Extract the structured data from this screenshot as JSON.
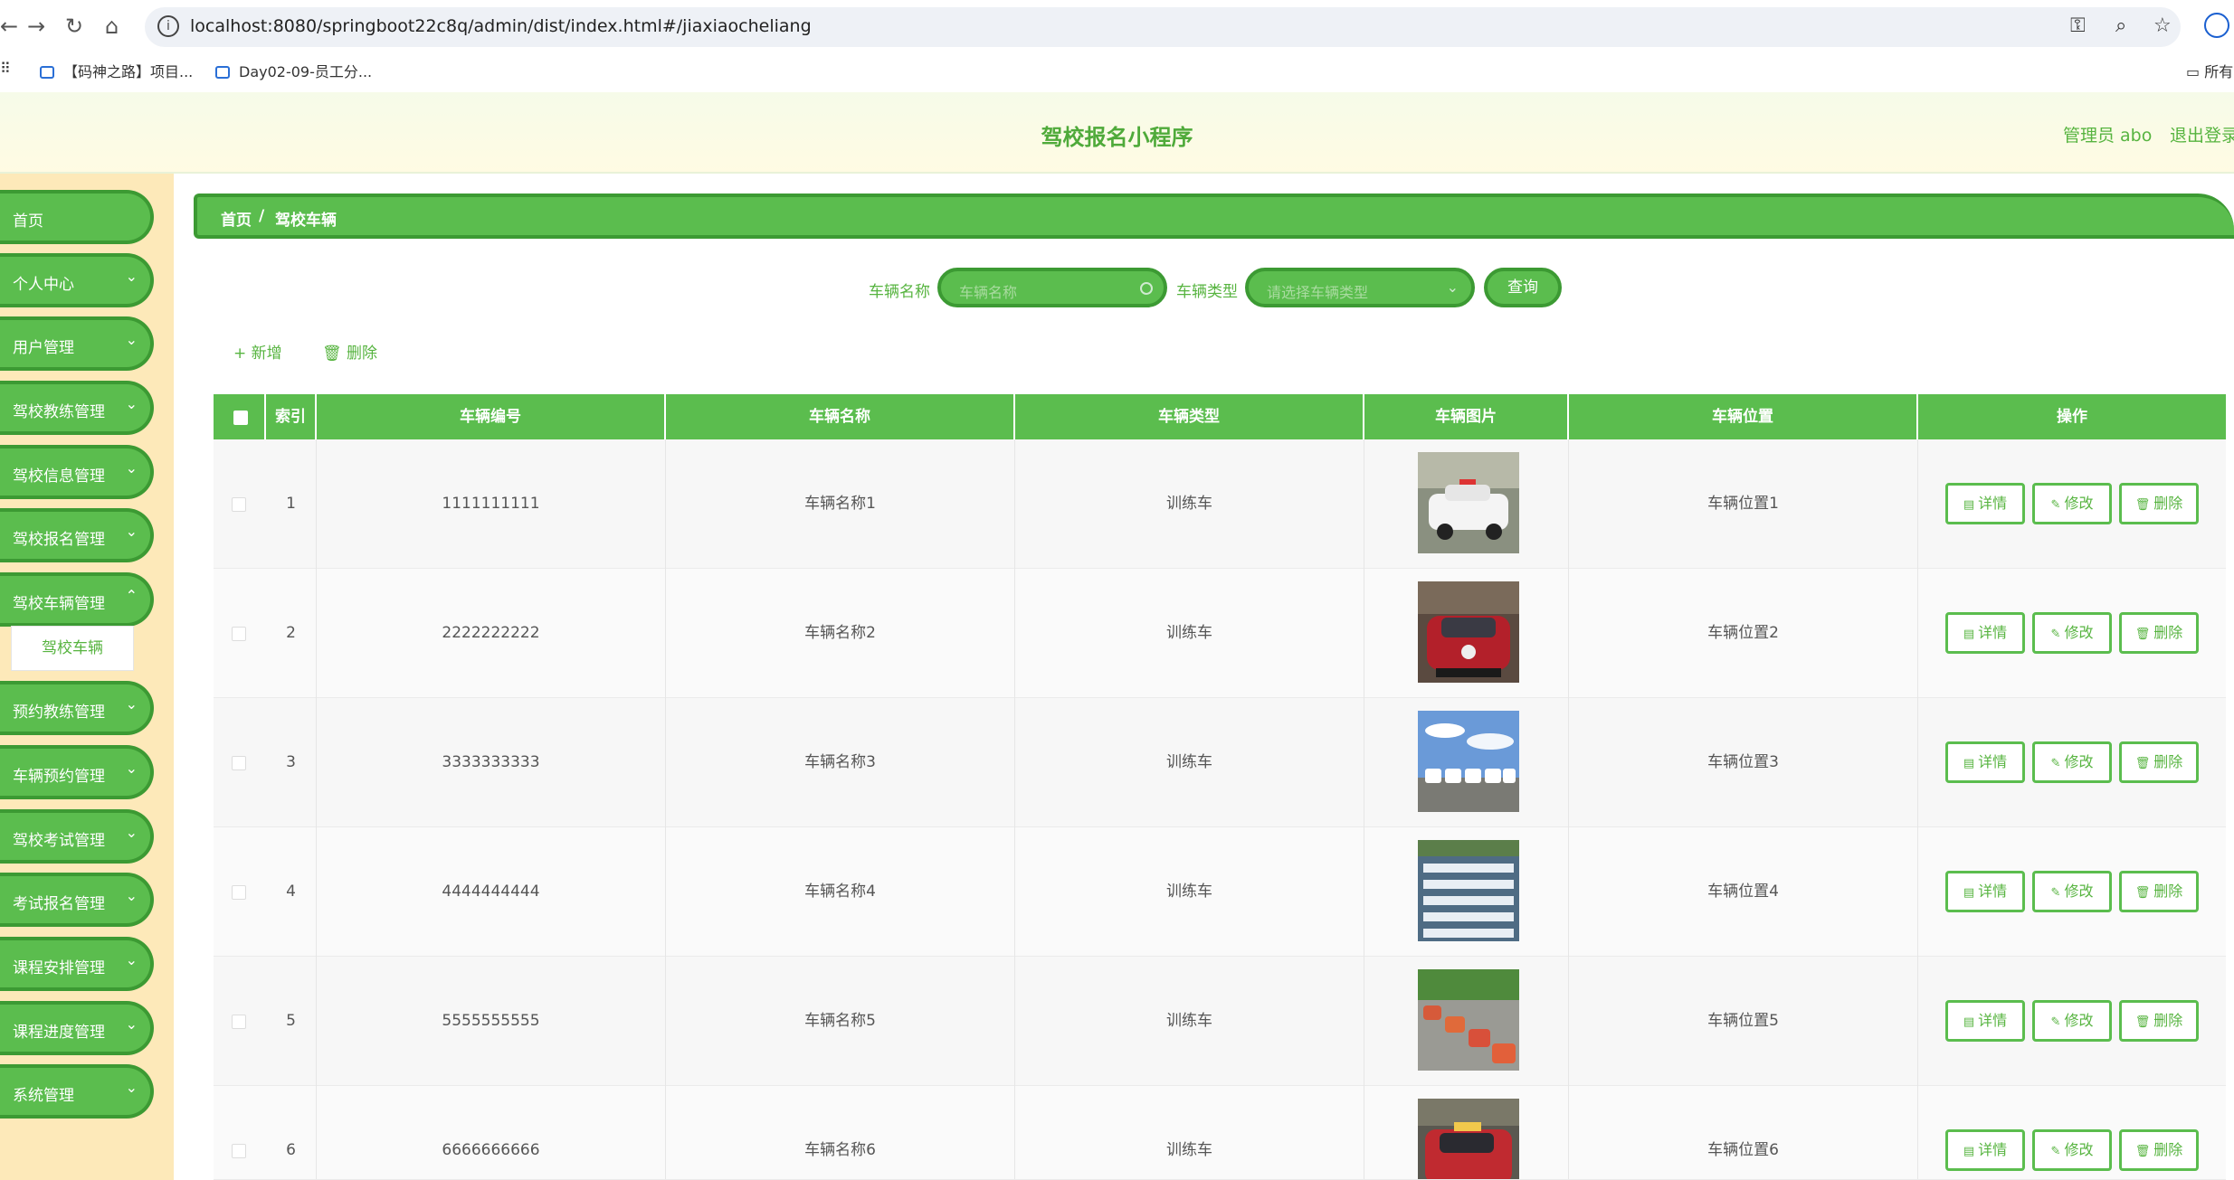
{
  "browser": {
    "url": "localhost:8080/springboot22c8q/admin/dist/index.html#/jiaxiaocheliang",
    "bookmarks": [
      "【码神之路】项目...",
      "Day02-09-员工分..."
    ],
    "bookmarks_folder": "所有"
  },
  "header": {
    "title": "驾校报名小程序",
    "admin": "管理员 abo",
    "logout": "退出登录"
  },
  "sidebar": {
    "items": [
      {
        "label": "首页",
        "has_chevron": false
      },
      {
        "label": "个人中心",
        "has_chevron": true
      },
      {
        "label": "用户管理",
        "has_chevron": true
      },
      {
        "label": "驾校教练管理",
        "has_chevron": true
      },
      {
        "label": "驾校信息管理",
        "has_chevron": true
      },
      {
        "label": "驾校报名管理",
        "has_chevron": true
      },
      {
        "label": "驾校车辆管理",
        "has_chevron": true
      },
      {
        "label": "预约教练管理",
        "has_chevron": true
      },
      {
        "label": "车辆预约管理",
        "has_chevron": true
      },
      {
        "label": "驾校考试管理",
        "has_chevron": true
      },
      {
        "label": "考试报名管理",
        "has_chevron": true
      },
      {
        "label": "课程安排管理",
        "has_chevron": true
      },
      {
        "label": "课程进度管理",
        "has_chevron": true
      },
      {
        "label": "系统管理",
        "has_chevron": true
      }
    ],
    "active_sub": "驾校车辆"
  },
  "breadcrumb": {
    "home": "首页",
    "sep": "/",
    "current": "驾校车辆"
  },
  "search": {
    "name_label": "车辆名称",
    "name_placeholder": "车辆名称",
    "type_label": "车辆类型",
    "type_placeholder": "请选择车辆类型",
    "query_label": "查询"
  },
  "toolbar": {
    "add_label": "新增",
    "delete_label": "删除"
  },
  "table": {
    "columns": [
      "索引",
      "车辆编号",
      "车辆名称",
      "车辆类型",
      "车辆图片",
      "车辆位置",
      "操作"
    ],
    "rows": [
      {
        "index": "1",
        "code": "1111111111",
        "name": "车辆名称1",
        "type": "训练车",
        "location": "车辆位置1"
      },
      {
        "index": "2",
        "code": "2222222222",
        "name": "车辆名称2",
        "type": "训练车",
        "location": "车辆位置2"
      },
      {
        "index": "3",
        "code": "3333333333",
        "name": "车辆名称3",
        "type": "训练车",
        "location": "车辆位置3"
      },
      {
        "index": "4",
        "code": "4444444444",
        "name": "车辆名称4",
        "type": "训练车",
        "location": "车辆位置4"
      },
      {
        "index": "5",
        "code": "5555555555",
        "name": "车辆名称5",
        "type": "训练车",
        "location": "车辆位置5"
      },
      {
        "index": "6",
        "code": "6666666666",
        "name": "车辆名称6",
        "type": "训练车",
        "location": "车辆位置6"
      }
    ],
    "actions": {
      "detail": "详情",
      "edit": "修改",
      "delete": "删除"
    }
  },
  "colors": {
    "primary": "#5bbd4e",
    "primary_dark": "#3c9a33",
    "sidebar_bg": "#fde9b9",
    "header_text": "#4faa3a"
  }
}
